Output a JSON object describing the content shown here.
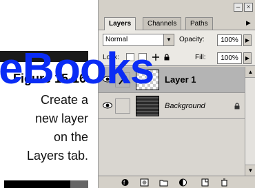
{
  "watermark": {
    "text": "eBooks"
  },
  "figure": {
    "label": "Figure 15-16:",
    "caption_lines": [
      "Create a",
      "new layer",
      "on the",
      "Layers tab."
    ]
  },
  "palette": {
    "tabs": [
      {
        "label": "Layers",
        "active": true
      },
      {
        "label": "Channels",
        "active": false
      },
      {
        "label": "Paths",
        "active": false
      }
    ],
    "blend_mode": "Normal",
    "opacity_label": "Opacity:",
    "opacity_value": "100%",
    "lock_label": "Lock:",
    "fill_label": "Fill:",
    "fill_value": "100%",
    "layers": [
      {
        "name": "Layer 1",
        "visible": true,
        "selected": true,
        "linked_brush": true
      },
      {
        "name": "Background",
        "visible": true,
        "selected": false,
        "locked": true
      }
    ],
    "bottom_icons": [
      "layer-style-icon",
      "add-mask-icon",
      "new-set-icon",
      "adjustment-layer-icon",
      "new-layer-icon",
      "trash-icon"
    ]
  },
  "colors": {
    "watermark_blue": "#0a2cf5",
    "palette_bg": "#d4d0c8",
    "selected_row": "#b4b4b4"
  }
}
